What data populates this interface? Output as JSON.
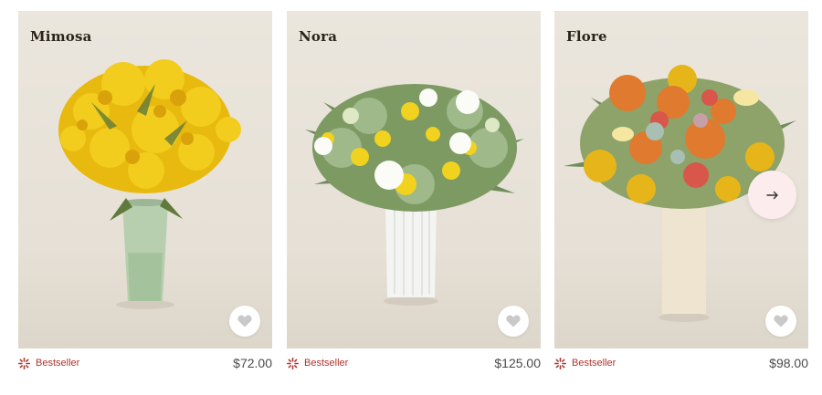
{
  "products": [
    {
      "name": "Mimosa",
      "badge": "Bestseller",
      "price": "$72.00"
    },
    {
      "name": "Nora",
      "badge": "Bestseller",
      "price": "$125.00"
    },
    {
      "name": "Flore",
      "badge": "Bestseller",
      "price": "$98.00"
    }
  ],
  "icons": {
    "favorite": "heart-icon",
    "badge": "bestseller-burst-icon",
    "next": "arrow-right-icon"
  },
  "colors": {
    "badge_red": "#b0342c",
    "next_button_bg": "#fdecee",
    "photo_background": "#e8e2d8"
  }
}
